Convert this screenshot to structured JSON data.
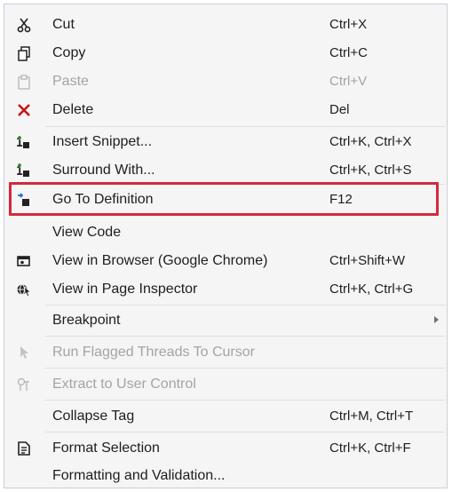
{
  "menu": {
    "items": [
      {
        "label": "Cut",
        "shortcut": "Ctrl+X",
        "icon": "scissors-icon"
      },
      {
        "label": "Copy",
        "shortcut": "Ctrl+C",
        "icon": "copy-icon"
      },
      {
        "label": "Paste",
        "shortcut": "Ctrl+V",
        "icon": "paste-icon",
        "disabled": true
      },
      {
        "label": "Delete",
        "shortcut": "Del",
        "icon": "delete-x-icon"
      },
      {
        "label": "Insert Snippet...",
        "shortcut": "Ctrl+K, Ctrl+X",
        "icon": "insert-snippet-icon"
      },
      {
        "label": "Surround With...",
        "shortcut": "Ctrl+K, Ctrl+S",
        "icon": "surround-with-icon"
      },
      {
        "label": "Go To Definition",
        "shortcut": "F12",
        "icon": "go-to-definition-icon",
        "highlighted": true
      },
      {
        "label": "View Code",
        "shortcut": "",
        "icon": ""
      },
      {
        "label": "View in Browser (Google Chrome)",
        "shortcut": "Ctrl+Shift+W",
        "icon": "view-in-browser-icon"
      },
      {
        "label": "View in Page Inspector",
        "shortcut": "Ctrl+K, Ctrl+G",
        "icon": "page-inspector-icon"
      },
      {
        "label": "Breakpoint",
        "shortcut": "",
        "icon": "",
        "submenu": true
      },
      {
        "label": "Run Flagged Threads To Cursor",
        "shortcut": "",
        "icon": "run-to-cursor-icon",
        "disabled": true
      },
      {
        "label": "Extract to User Control",
        "shortcut": "",
        "icon": "extract-user-control-icon",
        "disabled": true
      },
      {
        "label": "Collapse Tag",
        "shortcut": "Ctrl+M, Ctrl+T",
        "icon": ""
      },
      {
        "label": "Format Selection",
        "shortcut": "Ctrl+K, Ctrl+F",
        "icon": "format-selection-icon"
      },
      {
        "label": "Formatting and Validation...",
        "shortcut": "",
        "icon": ""
      }
    ]
  },
  "colors": {
    "menu_background": "#f5f5f5",
    "highlight_border": "#d3283d",
    "text": "#1e1e1e",
    "disabled_text": "#a2a4a5",
    "delete_icon": "#c4161c",
    "accent_blue": "#1e72c8",
    "snippet_green": "#388a34"
  }
}
